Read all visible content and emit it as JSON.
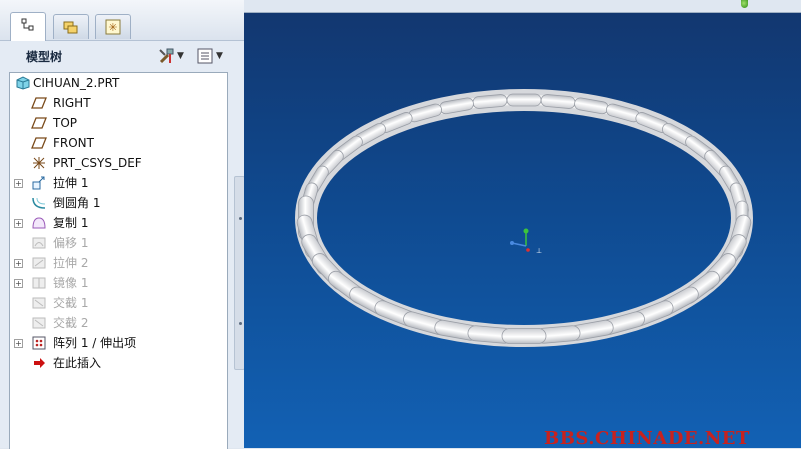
{
  "tabs": [
    {
      "name": "model-tree-tab",
      "icon": "tree-icon",
      "active": true
    },
    {
      "name": "folder-browser-tab",
      "icon": "folders-icon",
      "active": false
    },
    {
      "name": "favorites-tab",
      "icon": "star-icon",
      "active": false
    }
  ],
  "model_tree": {
    "title": "模型树",
    "settings_icon": "tools-icon",
    "show_icon": "list-icon",
    "items": [
      {
        "label": "CIHUAN_2.PRT",
        "icon": "part-icon",
        "expander": false,
        "dim": false
      },
      {
        "label": "RIGHT",
        "icon": "datum-plane-icon",
        "expander": false,
        "dim": false
      },
      {
        "label": "TOP",
        "icon": "datum-plane-icon",
        "expander": false,
        "dim": false
      },
      {
        "label": "FRONT",
        "icon": "datum-plane-icon",
        "expander": false,
        "dim": false
      },
      {
        "label": "PRT_CSYS_DEF",
        "icon": "csys-icon",
        "expander": false,
        "dim": false
      },
      {
        "label": "拉伸 1",
        "icon": "extrude-icon",
        "expander": true,
        "dim": false
      },
      {
        "label": "倒圆角 1",
        "icon": "round-icon",
        "expander": false,
        "dim": false
      },
      {
        "label": "复制 1",
        "icon": "copy-icon",
        "expander": true,
        "dim": false
      },
      {
        "label": "偏移 1",
        "icon": "offset-icon",
        "expander": false,
        "dim": true
      },
      {
        "label": "拉伸 2",
        "icon": "extrude-icon",
        "expander": true,
        "dim": true
      },
      {
        "label": "镜像 1",
        "icon": "mirror-icon",
        "expander": true,
        "dim": true
      },
      {
        "label": "交截 1",
        "icon": "intersect-icon",
        "expander": false,
        "dim": true
      },
      {
        "label": "交截 2",
        "icon": "intersect-icon",
        "expander": false,
        "dim": true
      },
      {
        "label": "阵列 1 / 伸出项",
        "icon": "pattern-icon",
        "expander": true,
        "dim": false
      },
      {
        "label": "在此插入",
        "icon": "insert-here-arrow-icon",
        "expander": false,
        "dim": false
      }
    ]
  },
  "viewport": {
    "watermark": "BBS.CHINADE.NET",
    "background_top": "#123770",
    "background_bottom": "#1261b4"
  },
  "colors": {
    "status_led": "#3da21f",
    "model": "#f2f2f2",
    "insert_arrow": "#cc1111"
  }
}
